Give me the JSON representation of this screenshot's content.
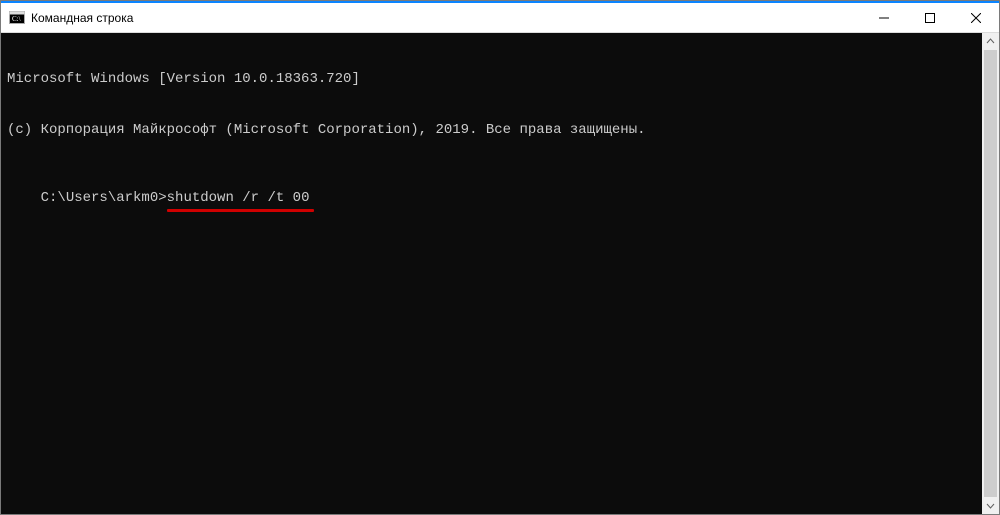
{
  "titlebar": {
    "title": "Командная строка"
  },
  "terminal": {
    "line1": "Microsoft Windows [Version 10.0.18363.720]",
    "line2": "(c) Корпорация Майкрософт (Microsoft Corporation), 2019. Все права защищены.",
    "blank": "",
    "prompt": "C:\\Users\\arkm0>",
    "command": "shutdown /r /t 00"
  }
}
